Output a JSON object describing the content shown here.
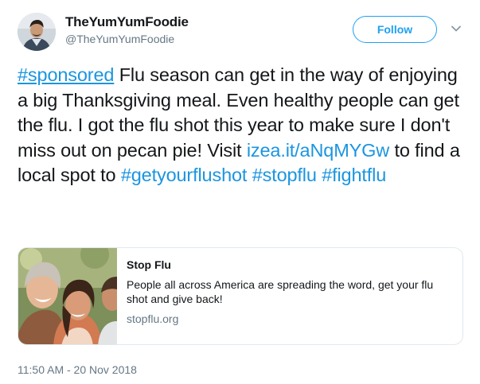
{
  "author": {
    "display_name": "TheYumYumFoodie",
    "handle": "@TheYumYumFoodie",
    "avatar_icon": "user-avatar"
  },
  "header": {
    "follow_label": "Follow",
    "more_icon": "chevron-down-icon"
  },
  "tweet": {
    "hashtag_sponsored": "#sponsored",
    "text_1": " Flu season can get in the way of enjoying a big Thanksgiving meal. Even healthy people can get the flu. I got the flu shot this year to make sure I don't miss out on pecan pie! Visit ",
    "link_url": "izea.it/aNqMYGw",
    "text_2": " to find a local spot to ",
    "hashtag_getyourflushot": "#getyourflushot",
    "hashtag_stopflu": "#stopflu",
    "hashtag_fightflu": "#fightflu"
  },
  "card": {
    "title": "Stop Flu",
    "description": "People all across America are spreading the word, get your flu shot and give back!",
    "domain": "stopflu.org"
  },
  "timestamp": "11:50 AM - 20 Nov 2018",
  "colors": {
    "link": "#1b95e0",
    "follow": "#1da1f2",
    "secondary_text": "#657786",
    "border": "#e1e8ed"
  }
}
